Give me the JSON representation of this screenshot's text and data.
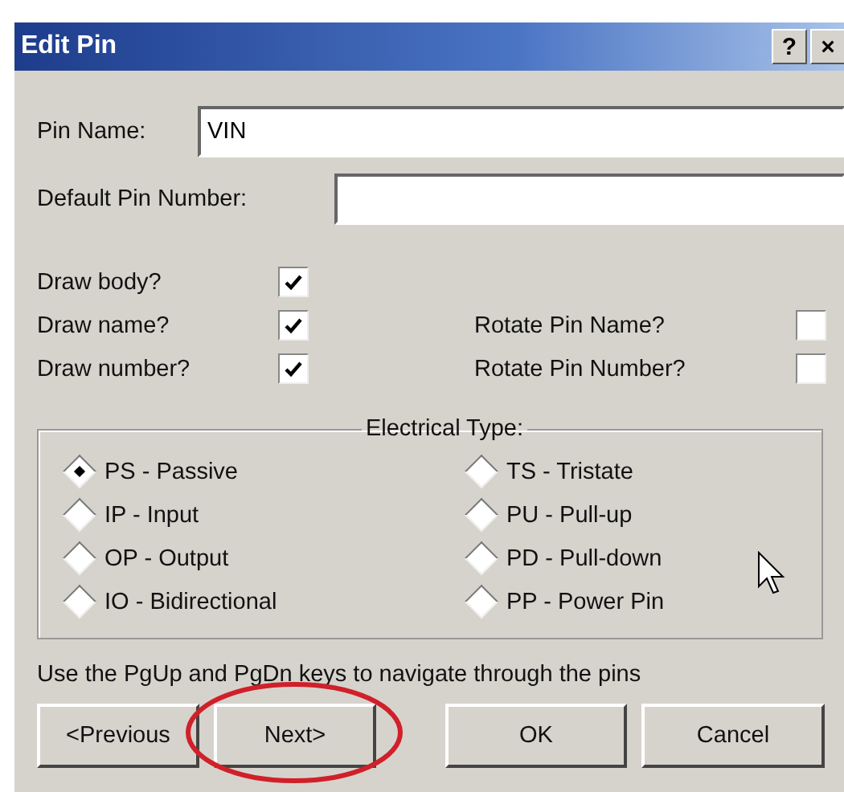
{
  "window": {
    "title": "Edit Pin",
    "title_buttons": [
      "?",
      "×"
    ]
  },
  "fields": [
    {
      "label": "Pin Name:",
      "value": "VIN"
    },
    {
      "label": "Default Pin Number:"
    }
  ],
  "options_left": [
    {
      "label": "Draw body?",
      "checked": true
    },
    {
      "label": "Draw name?",
      "checked": true
    },
    {
      "label": "Draw number?",
      "checked": true
    }
  ],
  "options_right": [
    {
      "label": "Rotate Pin Name?",
      "checked": false
    },
    {
      "label": "Rotate Pin Number?",
      "checked": false
    }
  ],
  "electrical_type": {
    "title": "Electrical Type:",
    "options": [
      {
        "label": "PS - Passive",
        "selected": true
      },
      {
        "label": "TS - Tristate",
        "selected": false
      },
      {
        "label": "IP - Input",
        "selected": false
      },
      {
        "label": "PU - Pull-up",
        "selected": false
      },
      {
        "label": "OP - Output",
        "selected": false
      },
      {
        "label": "PD - Pull-down",
        "selected": false
      },
      {
        "label": "IO - Bidirectional",
        "selected": false
      },
      {
        "label": "PP - Power Pin",
        "selected": false
      }
    ]
  },
  "hint": "Use the PgUp and PgDn keys to navigate through the pins",
  "buttons": [
    {
      "label": "<Previous",
      "highlighted": false
    },
    {
      "label": "Next>",
      "highlighted": true
    },
    {
      "label": "OK",
      "highlighted": false
    },
    {
      "label": "Cancel",
      "highlighted": false
    }
  ]
}
